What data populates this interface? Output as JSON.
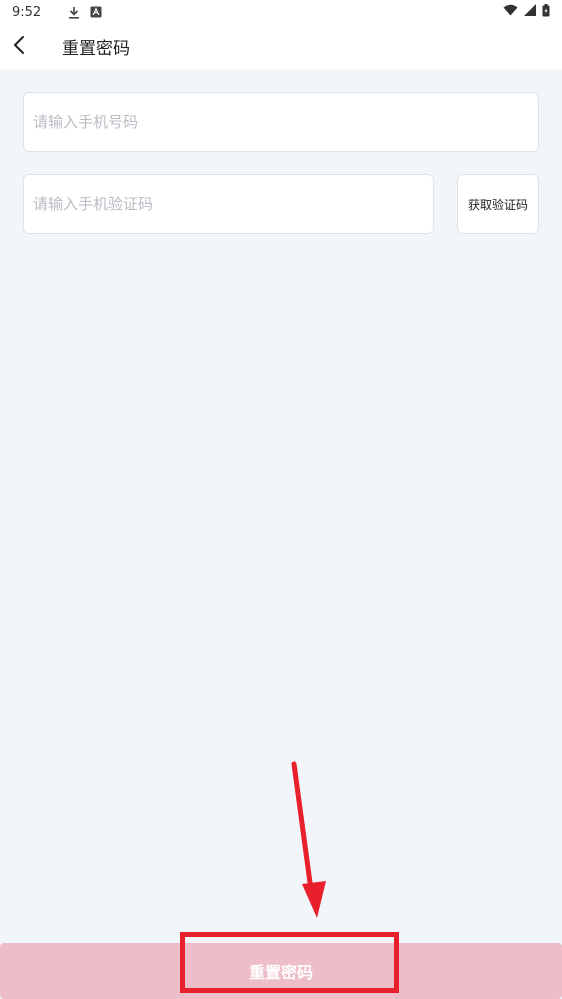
{
  "status_bar": {
    "time": "9:52",
    "icons_left": [
      "download-icon",
      "a-badge-icon"
    ],
    "icons_right": [
      "wifi-icon",
      "signal-icon",
      "battery-icon"
    ]
  },
  "app_bar": {
    "back_icon": "chevron-left-icon",
    "title": "重置密码"
  },
  "form": {
    "phone_placeholder": "请输入手机号码",
    "phone_value": "",
    "code_placeholder": "请输入手机验证码",
    "code_value": "",
    "get_code_label": "获取验证码"
  },
  "footer": {
    "reset_label": "重置密码"
  },
  "colors": {
    "background": "#f2f6fb",
    "button_bg": "#edbdc8",
    "annotation": "#e8202b"
  }
}
